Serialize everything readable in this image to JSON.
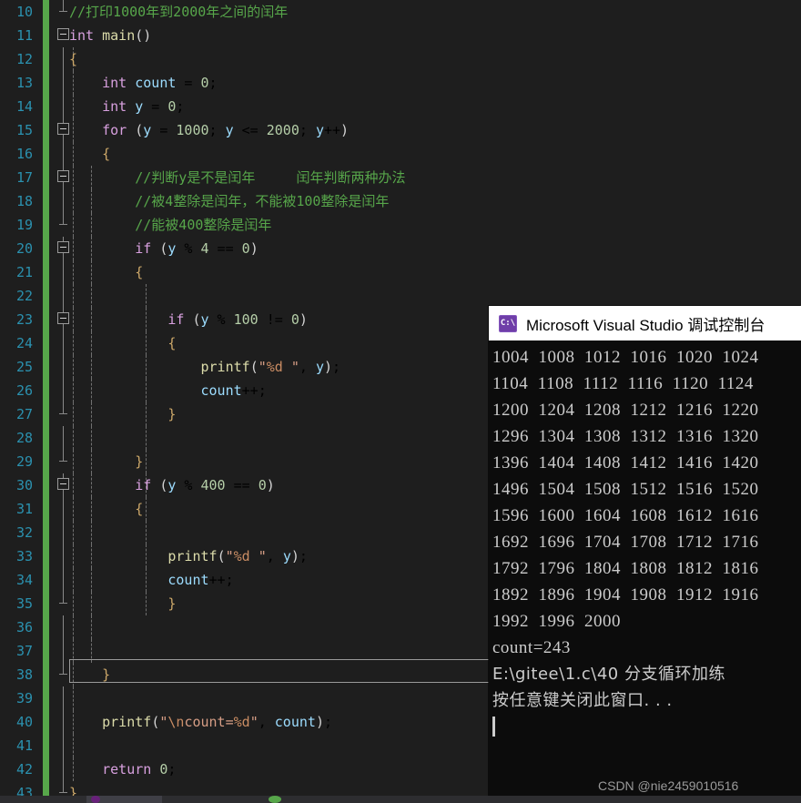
{
  "editor": {
    "first_line_number": 10,
    "highlighted_line": 38,
    "lines": [
      {
        "n": 10,
        "indent_guides": [],
        "fold": "end-top",
        "code": "//打印1000年到2000年之间的闰年",
        "kind": "comment"
      },
      {
        "n": 11,
        "code": "int main()"
      },
      {
        "n": 12,
        "code": "{"
      },
      {
        "n": 13,
        "code": "    int count = 0;"
      },
      {
        "n": 14,
        "code": "    int y = 0;"
      },
      {
        "n": 15,
        "code": "    for (y = 1000; y <= 2000; y++)"
      },
      {
        "n": 16,
        "code": "    {"
      },
      {
        "n": 17,
        "code": "        //判断y是不是闰年     闰年判断两种办法"
      },
      {
        "n": 18,
        "code": "        //被4整除是闰年，不能被100整除是闰年"
      },
      {
        "n": 19,
        "code": "        //能被400整除是闰年"
      },
      {
        "n": 20,
        "code": "        if (y % 4 == 0)"
      },
      {
        "n": 21,
        "code": "        {"
      },
      {
        "n": 22,
        "code": ""
      },
      {
        "n": 23,
        "code": "            if (y % 100 != 0)"
      },
      {
        "n": 24,
        "code": "            {"
      },
      {
        "n": 25,
        "code": "                printf(\"%d \", y);"
      },
      {
        "n": 26,
        "code": "                count++;"
      },
      {
        "n": 27,
        "code": "            }"
      },
      {
        "n": 28,
        "code": ""
      },
      {
        "n": 29,
        "code": "        }"
      },
      {
        "n": 30,
        "code": "        if (y % 400 == 0)"
      },
      {
        "n": 31,
        "code": "        {"
      },
      {
        "n": 32,
        "code": ""
      },
      {
        "n": 33,
        "code": "            printf(\"%d \", y);"
      },
      {
        "n": 34,
        "code": "            count++;"
      },
      {
        "n": 35,
        "code": "            }"
      },
      {
        "n": 36,
        "code": ""
      },
      {
        "n": 37,
        "code": ""
      },
      {
        "n": 38,
        "code": "    }"
      },
      {
        "n": 39,
        "code": ""
      },
      {
        "n": 40,
        "code": "    printf(\"\\ncount=%d\", count);"
      },
      {
        "n": 41,
        "code": ""
      },
      {
        "n": 42,
        "code": "    return 0;"
      },
      {
        "n": 43,
        "code": "}"
      }
    ]
  },
  "console": {
    "title": "Microsoft Visual Studio 调试控制台",
    "icon": "console-cmd-icon",
    "output_lines": [
      "1004  1008  1012  1016  1020  1024",
      "1104  1108  1112  1116  1120  1124",
      "1200  1204  1208  1212  1216  1220",
      "1296  1304  1308  1312  1316  1320",
      "1396  1404  1408  1412  1416  1420",
      "1496  1504  1508  1512  1516  1520",
      "1596  1600  1604  1608  1612  1616",
      "1692  1696  1704  1708  1712  1716",
      "1792  1796  1804  1808  1812  1816",
      "1892  1896  1904  1908  1912  1916",
      "1992  1996  2000",
      "count=243",
      "E:\\gitee\\1.c\\40 分支循环加练",
      "按任意键关闭此窗口. . ."
    ],
    "count_result": "count=243"
  },
  "watermark": {
    "text": "CSDN @nie2459010516"
  },
  "statusbar": {
    "text": ""
  },
  "colors": {
    "editor_background": "#1e1e1e",
    "line_number": "#2b91af",
    "comment": "#57a64a",
    "keyword": "#d8a0df",
    "number": "#b5cea8",
    "variable": "#9cdcfe",
    "function": "#dcdcaa",
    "string": "#d69d85",
    "change_bar": "#57a64a",
    "console_background": "#0c0c0c",
    "console_titlebar": "#ffffff",
    "console_icon": "#6f3ea8"
  }
}
